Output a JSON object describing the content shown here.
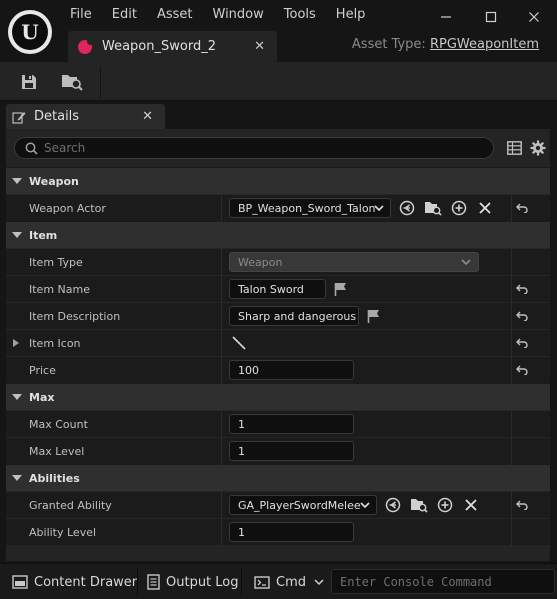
{
  "app": {
    "logo_text": "U",
    "menu": [
      "File",
      "Edit",
      "Asset",
      "Window",
      "Tools",
      "Help"
    ],
    "window_controls": [
      "minimize-icon",
      "maximize-icon",
      "close-icon"
    ]
  },
  "document_tab": {
    "label": "Weapon_Sword_2",
    "close": "✕",
    "icon_color": "#e0245e"
  },
  "asset_type": {
    "label": "Asset Type:",
    "value": "RPGWeaponItem"
  },
  "toolbar": {
    "buttons": [
      "save-icon",
      "browse-icon"
    ]
  },
  "details": {
    "tab_label": "Details",
    "tab_close": "✕",
    "search_placeholder": "Search",
    "categories": {
      "weapon": "Weapon",
      "item": "Item",
      "max": "Max",
      "abilities": "Abilities"
    },
    "properties": {
      "weapon_actor": {
        "label": "Weapon Actor",
        "value": "BP_Weapon_Sword_Talon"
      },
      "item_type": {
        "label": "Item Type",
        "value": "Weapon"
      },
      "item_name": {
        "label": "Item Name",
        "value": "Talon Sword"
      },
      "item_description": {
        "label": "Item Description",
        "value": "Sharp and dangerous"
      },
      "item_icon": {
        "label": "Item Icon"
      },
      "price": {
        "label": "Price",
        "value": "100"
      },
      "max_count": {
        "label": "Max Count",
        "value": "1"
      },
      "max_level": {
        "label": "Max Level",
        "value": "1"
      },
      "granted_ability": {
        "label": "Granted Ability",
        "value": "GA_PlayerSwordMelee"
      },
      "ability_level": {
        "label": "Ability Level",
        "value": "1"
      }
    }
  },
  "statusbar": {
    "content_drawer": "Content Drawer",
    "output_log": "Output Log",
    "cmd": "Cmd",
    "console_placeholder": "Enter Console Command"
  },
  "colors": {
    "background": "#151515",
    "panel": "#242424",
    "accent": "#e0245e"
  }
}
